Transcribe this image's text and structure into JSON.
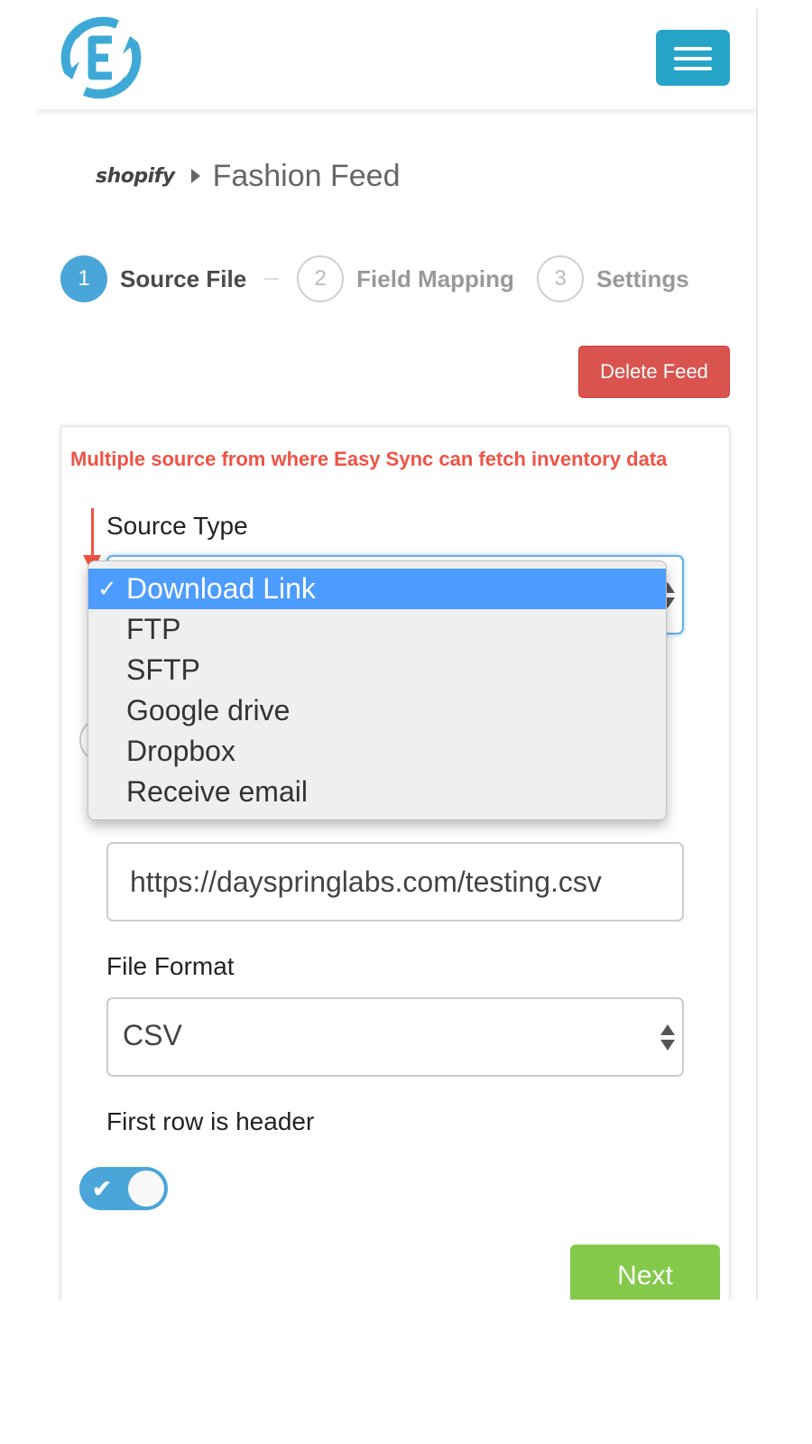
{
  "header": {
    "logo_icon": "easy-sync-e-logo",
    "menu_icon": "hamburger-menu-icon",
    "brand_color": "#25a4c8"
  },
  "breadcrumb": {
    "platform": "shopify",
    "separator_icon": "caret-right-icon",
    "feed_name": "Fashion Feed"
  },
  "steps": [
    {
      "number": "1",
      "label": "Source File",
      "state": "active"
    },
    {
      "number": "2",
      "label": "Field Mapping",
      "state": "inactive"
    },
    {
      "number": "3",
      "label": "Settings",
      "state": "inactive"
    }
  ],
  "actions": {
    "delete_label": "Delete Feed",
    "next_label": "Next"
  },
  "annotation": {
    "text": "Multiple source from where Easy Sync can fetch inventory data",
    "color": "#ef5345"
  },
  "form": {
    "source_type": {
      "label": "Source Type",
      "selected": "Download Link",
      "options": [
        "Download Link",
        "FTP",
        "SFTP",
        "Google drive",
        "Dropbox",
        "Receive email"
      ]
    },
    "url": {
      "value": "https://dayspringlabs.com/testing.csv"
    },
    "file_format": {
      "label": "File Format",
      "selected": "CSV"
    },
    "first_row_header": {
      "label": "First row is header",
      "enabled": true,
      "check_glyph": "✔"
    }
  },
  "colors": {
    "active_step": "#4aa6d8",
    "delete": "#d9534f",
    "next": "#84c94a",
    "dropdown_highlight": "#4d9cff"
  }
}
